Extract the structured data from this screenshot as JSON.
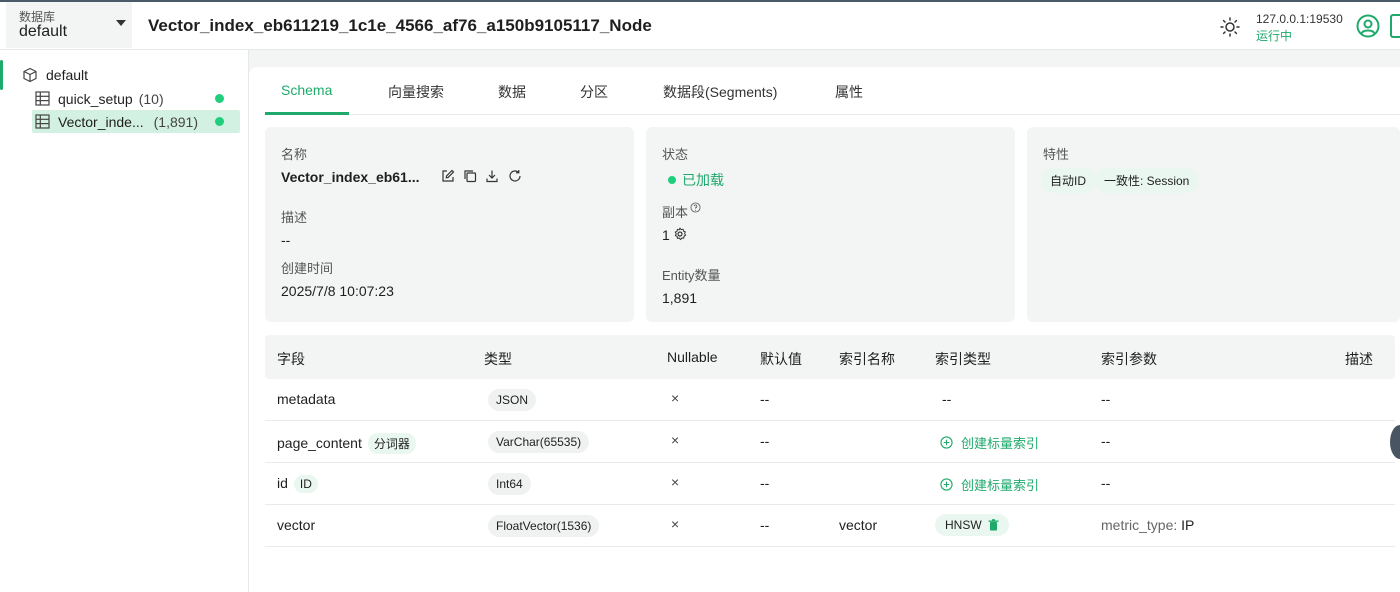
{
  "topbar": {
    "db_label": "数据库",
    "db_value": "default",
    "collection_title": "Vector_index_eb611219_1c1e_4566_af76_a150b9105117_Node",
    "server_address": "127.0.0.1:19530",
    "server_status": "运行中"
  },
  "sidebar": {
    "database": "default",
    "collections": [
      {
        "name": "quick_setup",
        "count": "(10)"
      },
      {
        "name": "Vector_inde...",
        "count": "(1,891)"
      }
    ]
  },
  "tabs": [
    "Schema",
    "向量搜索",
    "数据",
    "分区",
    "数据段(Segments)",
    "属性"
  ],
  "info": {
    "name_label": "名称",
    "name_value": "Vector_index_eb61...",
    "desc_label": "描述",
    "desc_value": "--",
    "created_label": "创建时间",
    "created_value": "2025/7/8 10:07:23",
    "status_label": "状态",
    "status_value": "已加载",
    "replica_label": "副本",
    "replica_value": "1",
    "entity_label": "Entity数量",
    "entity_value": "1,891",
    "features_label": "特性",
    "feature_autoid": "自动ID",
    "feature_consistency": "一致性: Session"
  },
  "table": {
    "headers": [
      "字段",
      "类型",
      "Nullable",
      "默认值",
      "索引名称",
      "索引类型",
      "索引参数",
      "描述"
    ],
    "rows": [
      {
        "field": "metadata",
        "tag": "",
        "type": "JSON",
        "nullable": "×",
        "default": "--",
        "index_name": "",
        "index_type": "--",
        "index_params": "--"
      },
      {
        "field": "page_content",
        "tag": "分词器",
        "type": "VarChar(65535)",
        "nullable": "×",
        "default": "--",
        "index_name": "",
        "index_type": "创建标量索引",
        "index_params": "--"
      },
      {
        "field": "id",
        "tag": "ID",
        "type": "Int64",
        "nullable": "×",
        "default": "--",
        "index_name": "",
        "index_type": "创建标量索引",
        "index_params": "--"
      },
      {
        "field": "vector",
        "tag": "",
        "type": "FloatVector(1536)",
        "nullable": "×",
        "default": "--",
        "index_name": "vector",
        "index_type": "HNSW",
        "index_params_key": "metric_type:",
        "index_params_val": "IP"
      }
    ]
  },
  "colors": {
    "accent": "#1faa6b",
    "status_dot": "#1fcf7d"
  }
}
